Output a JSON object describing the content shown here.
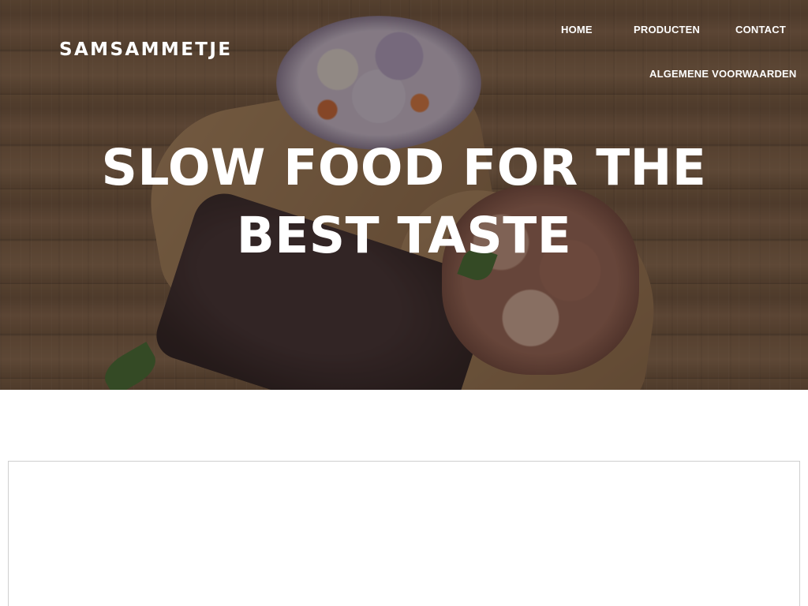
{
  "site": {
    "logo_text": "SAMSAMMETJE"
  },
  "nav": {
    "items": [
      {
        "label": "HOME"
      },
      {
        "label": "PRODUCTEN"
      },
      {
        "label": "CONTACT"
      },
      {
        "label": "ALGEMENE VOORWAARDEN"
      }
    ]
  },
  "hero": {
    "headline": "SLOW FOOD FOR THE BEST TASTE",
    "image_subject": "bbq-food-on-wooden-boards"
  },
  "colors": {
    "text_on_hero": "#ffffff",
    "page_background": "#ffffff",
    "card_border": "#cfcfcf"
  }
}
